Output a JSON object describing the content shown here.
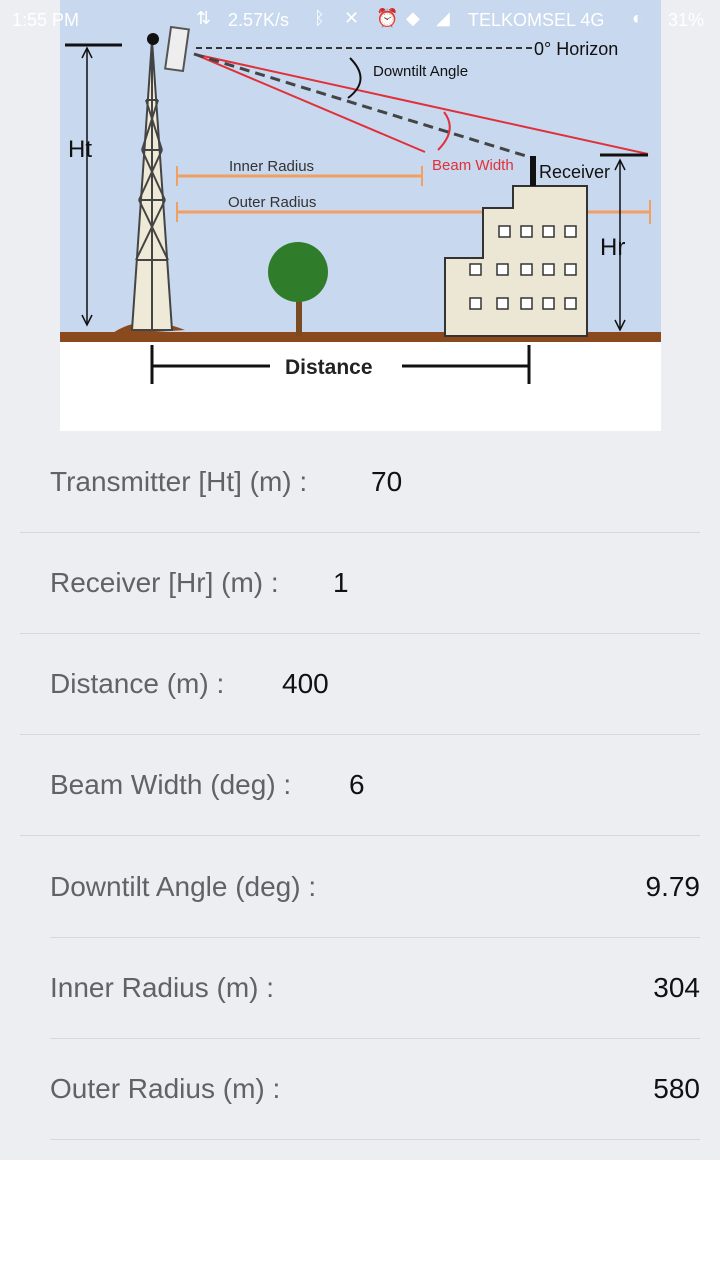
{
  "status_bar": {
    "time": "1:55 PM",
    "speed": "2.57K/s",
    "carrier": "TELKOMSEL 4G",
    "battery": "31%"
  },
  "diagram": {
    "transmitter": "Transmitter",
    "horizon": "0° Horizon",
    "downtilt": "Downtilt Angle",
    "ht": "Ht",
    "hr": "Hr",
    "inner_radius": "Inner Radius",
    "outer_radius": "Outer Radius",
    "beam_width": "Beam Width",
    "receiver": "Receiver",
    "distance": "Distance"
  },
  "form": {
    "transmitter": {
      "label": "Transmitter [Ht] (m) :",
      "value": "70"
    },
    "receiver": {
      "label": "Receiver [Hr] (m) :",
      "value": "1"
    },
    "distance": {
      "label": "Distance (m) :",
      "value": "400"
    },
    "beam_width": {
      "label": "Beam Width (deg) :",
      "value": "6"
    }
  },
  "results": {
    "downtilt": {
      "label": "Downtilt Angle (deg) :",
      "value": "9.79"
    },
    "inner_radius": {
      "label": "Inner Radius (m) :",
      "value": "304"
    },
    "outer_radius": {
      "label": "Outer Radius (m) :",
      "value": "580"
    }
  },
  "colors": {
    "sky": "#c8d8ee",
    "ground": "#8a4a1e",
    "beam": "#e0303a",
    "radius": "#f0a060"
  }
}
